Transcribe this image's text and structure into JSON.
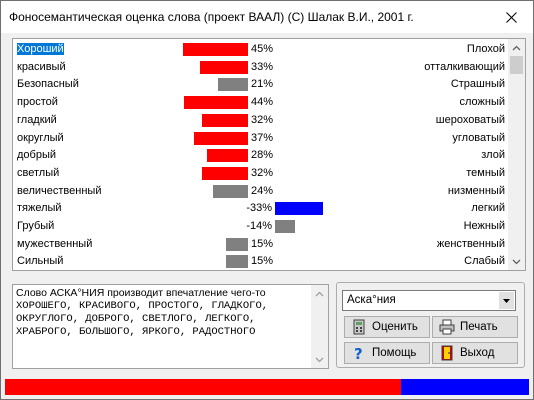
{
  "window": {
    "title": "Фоносемантическая оценка слова  (проект ВААЛ)  (С) Шалак В.И., 2001 г."
  },
  "scales": [
    {
      "left": "Хороший",
      "right": "Плохой",
      "percent": 45,
      "label": "45%",
      "color": "#ff0000",
      "selected": true
    },
    {
      "left": "красивый",
      "right": "отталкивающий",
      "percent": 33,
      "label": "33%",
      "color": "#ff0000"
    },
    {
      "left": "Безопасный",
      "right": "Страшный",
      "percent": 21,
      "label": "21%",
      "color": "#808080"
    },
    {
      "left": "простой",
      "right": "сложный",
      "percent": 44,
      "label": "44%",
      "color": "#ff0000"
    },
    {
      "left": "гладкий",
      "right": "шероховатый",
      "percent": 32,
      "label": "32%",
      "color": "#ff0000"
    },
    {
      "left": "округлый",
      "right": "угловатый",
      "percent": 37,
      "label": "37%",
      "color": "#ff0000"
    },
    {
      "left": "добрый",
      "right": "злой",
      "percent": 28,
      "label": "28%",
      "color": "#ff0000"
    },
    {
      "left": "светлый",
      "right": "темный",
      "percent": 32,
      "label": "32%",
      "color": "#ff0000"
    },
    {
      "left": "величественный",
      "right": "низменный",
      "percent": 24,
      "label": "24%",
      "color": "#808080"
    },
    {
      "left": "тяжелый",
      "right": "легкий",
      "percent": -33,
      "label": "-33%",
      "color": "#0000ff"
    },
    {
      "left": "Грубый",
      "right": "Нежный",
      "percent": -14,
      "label": "-14%",
      "color": "#808080"
    },
    {
      "left": "мужественный",
      "right": "женственный",
      "percent": 15,
      "label": "15%",
      "color": "#808080"
    },
    {
      "left": "Сильный",
      "right": "Слабый",
      "percent": 15,
      "label": "15%",
      "color": "#808080"
    }
  ],
  "result": {
    "line1": "Слово АСКА°НИЯ производит впечатление чего-то",
    "line2": "ХОРОШЕГО, КРАСИВОГО, ПРОСТОГО, ГЛАДКОГО,",
    "line3": "ОКРУГЛОГО, ДОБРОГО, СВЕТЛОГО, ЛЕГКОГО,",
    "line4": "ХРАБРОГО, БОЛЬШОГО, ЯРКОГО, РАДОСТНОГО"
  },
  "controls": {
    "word_value": "Аска°ния",
    "evaluate_label": "Оценить",
    "print_label": "Печать",
    "help_label": "Помощь",
    "exit_label": "Выход"
  },
  "strip": {
    "red_fraction": 0.755,
    "red_color": "#ff0000",
    "blue_color": "#0000ff"
  },
  "icons": {
    "close": "close-icon",
    "scroll_up": "chevron-up-icon",
    "scroll_down": "chevron-down-icon",
    "dropdown": "dropdown-arrow-icon",
    "evaluate": "calculator-icon",
    "print": "printer-icon",
    "help": "question-mark-icon",
    "exit": "door-exit-icon"
  }
}
